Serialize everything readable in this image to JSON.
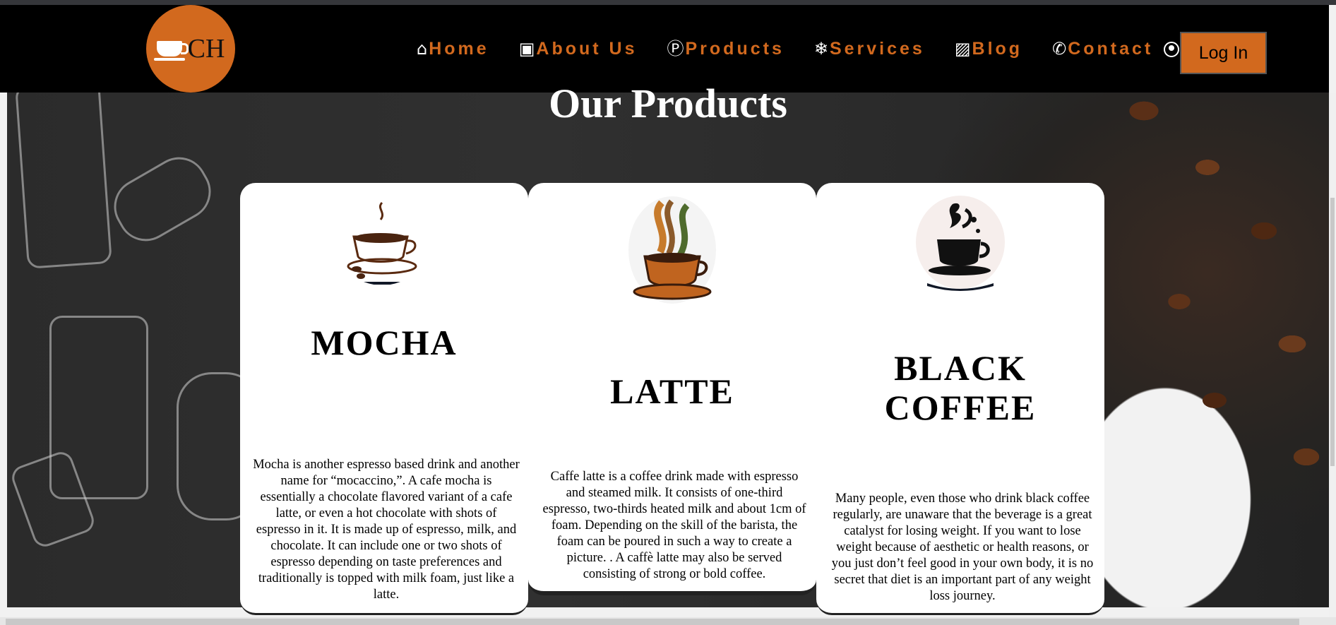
{
  "brand": {
    "logo_text": "CH"
  },
  "nav": {
    "items": [
      {
        "icon": "home-icon",
        "glyph": "⌂",
        "label": "Home"
      },
      {
        "icon": "contact-card-icon",
        "glyph": "▣",
        "label": "About Us"
      },
      {
        "icon": "p-circle-icon",
        "glyph": "Ⓟ",
        "label": "Products"
      },
      {
        "icon": "snowflake-icon",
        "glyph": "❄",
        "label": "Services"
      },
      {
        "icon": "image-icon",
        "glyph": "▨",
        "label": "Blog"
      },
      {
        "icon": "phone-icon",
        "glyph": "✆",
        "label": "Contact"
      }
    ],
    "login_label": "Log In"
  },
  "section": {
    "title": "Our Products"
  },
  "products": [
    {
      "title": "MOCHA",
      "description": "Mocha is another espresso based drink and another name for “mocaccino,”. A cafe mocha is essentially a chocolate flavored variant of a cafe latte, or even a hot chocolate with shots of espresso in it. It is made up of espresso, milk, and chocolate. It can include one or two shots of espresso depending on taste preferences and traditionally is topped with milk foam, just like a latte."
    },
    {
      "title": "LATTE",
      "description": "Caffe latte is a coffee drink made with espresso and steamed milk. It consists of one-third espresso, two-thirds heated milk and about 1cm of foam. Depending on the skill of the barista, the foam can be poured in such a way to create a picture. . A caffè latte may also be served consisting of strong or bold coffee."
    },
    {
      "title": "BLACK COFFEE",
      "description": "Many people, even those who drink black coffee regularly, are unaware that the beverage is a great catalyst for losing weight. If you want to lose weight because of aesthetic or health reasons, or you just don’t feel good in your own body, it is no secret that diet is an important part of any weight loss journey."
    }
  ],
  "colors": {
    "accent": "#d2691e",
    "nav_bg": "#000000",
    "card_bg": "#ffffff"
  }
}
